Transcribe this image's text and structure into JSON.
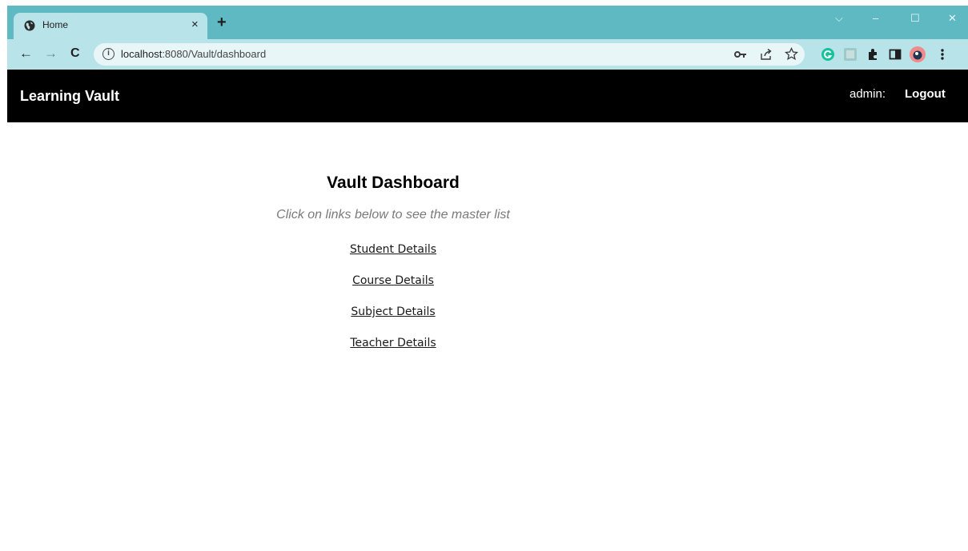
{
  "browser": {
    "tab": {
      "title": "Home",
      "favicon": "globe-icon",
      "close": "×"
    },
    "new_tab": "+",
    "window_controls": {
      "chevron": "⌵",
      "minimize": "–",
      "maximize": "☐",
      "close": "✕"
    },
    "nav": {
      "back": "←",
      "forward": "→",
      "reload": "C"
    },
    "address": {
      "host": "localhost",
      "path": ":8080/Vault/dashboard"
    }
  },
  "header": {
    "brand": "Learning Vault",
    "user": "admin:",
    "logout": "Logout"
  },
  "main": {
    "title": "Vault Dashboard",
    "subtitle": "Click on links below to see the master list",
    "links": [
      "Student Details",
      "Course Details",
      "Subject Details",
      "Teacher Details"
    ]
  },
  "colors": {
    "tabstrip": "#5eb9c3",
    "toolbar": "#b8e3e8",
    "header_bg": "#000000"
  }
}
